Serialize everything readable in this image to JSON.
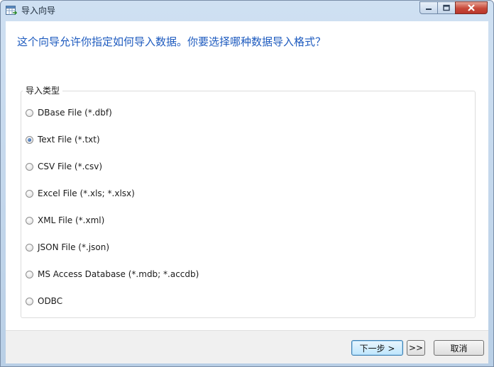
{
  "window": {
    "title": "导入向导"
  },
  "heading": "这个向导允许你指定如何导入数据。你要选择哪种数据导入格式？",
  "import_type": {
    "group_label": "导入类型",
    "options": [
      {
        "label": "DBase File (*.dbf)",
        "checked": false
      },
      {
        "label": "Text File (*.txt)",
        "checked": true
      },
      {
        "label": "CSV File (*.csv)",
        "checked": false
      },
      {
        "label": "Excel File (*.xls; *.xlsx)",
        "checked": false
      },
      {
        "label": "XML File (*.xml)",
        "checked": false
      },
      {
        "label": "JSON File (*.json)",
        "checked": false
      },
      {
        "label": "MS Access Database (*.mdb; *.accdb)",
        "checked": false
      },
      {
        "label": "ODBC",
        "checked": false
      }
    ]
  },
  "buttons": {
    "next": "下一步 >",
    "last": ">>",
    "cancel": "取消"
  },
  "colors": {
    "heading": "#1e5bbf",
    "titlebar": "#cfe0f2",
    "close_button": "#c8493a"
  }
}
